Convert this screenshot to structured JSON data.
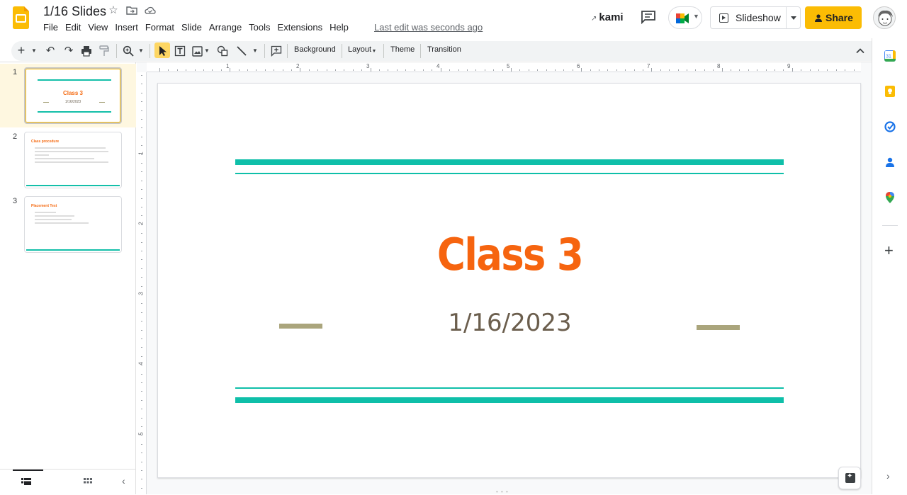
{
  "doc": {
    "title": "1/16 Slides",
    "last_edit": "Last edit was seconds ago"
  },
  "menu": [
    "File",
    "Edit",
    "View",
    "Insert",
    "Format",
    "Slide",
    "Arrange",
    "Tools",
    "Extensions",
    "Help"
  ],
  "header": {
    "kami_label": "kami",
    "slideshow_label": "Slideshow",
    "share_label": "Share"
  },
  "toolbar": {
    "background_label": "Background",
    "layout_label": "Layout",
    "theme_label": "Theme",
    "transition_label": "Transition"
  },
  "ruler": {
    "top": [
      "1",
      "2",
      "3",
      "4",
      "5",
      "6",
      "7",
      "8",
      "9"
    ],
    "left": [
      "1",
      "2",
      "3",
      "4",
      "5"
    ]
  },
  "slides": [
    {
      "number": "1",
      "title": "Class 3",
      "date": "1/16/2023"
    },
    {
      "number": "2",
      "title": "Class procedure"
    },
    {
      "number": "3",
      "title": "Placement Test"
    }
  ],
  "current_slide": {
    "title": "Class 3",
    "date": "1/16/2023"
  },
  "colors": {
    "accent_teal": "#0fbfa9",
    "title_orange": "#f6640f",
    "date_brown": "#6b5e4d",
    "dash_khaki": "#aaa57c",
    "share_yellow": "#fbbc04"
  },
  "side_panel_icons": [
    "calendar-icon",
    "keep-icon",
    "tasks-icon",
    "contacts-icon",
    "maps-icon",
    "add-icon"
  ]
}
